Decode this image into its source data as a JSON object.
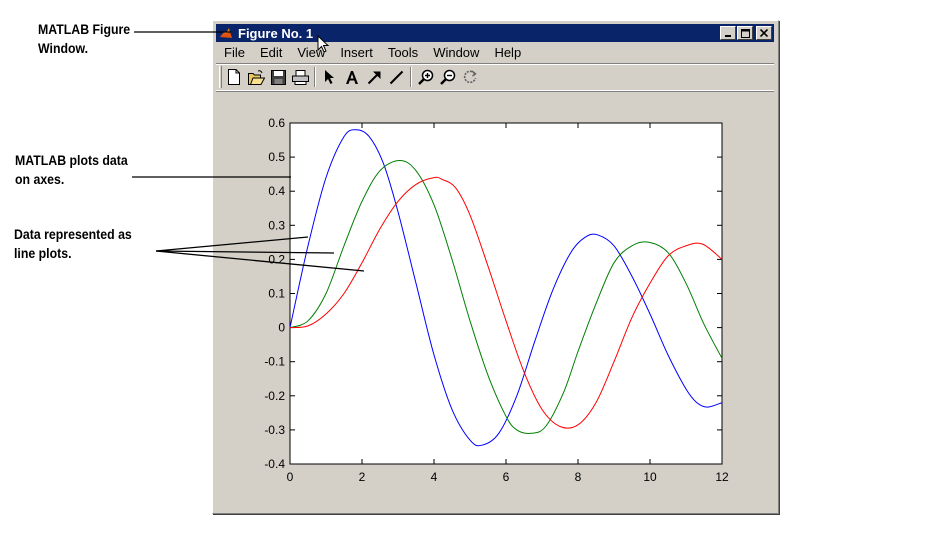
{
  "annotations": {
    "figure_window": [
      "MATLAB Figure",
      "Window."
    ],
    "axes": [
      "MATLAB plots data",
      "on axes."
    ],
    "line_plots": [
      "Data represented as",
      "line plots."
    ]
  },
  "window": {
    "title": "Figure No. 1",
    "controls": [
      "minimize-icon",
      "maximize-icon",
      "close-icon"
    ]
  },
  "menu": {
    "items": [
      "File",
      "Edit",
      "View",
      "Insert",
      "Tools",
      "Window",
      "Help"
    ]
  },
  "toolbar": {
    "groups": [
      [
        "new-file-icon",
        "open-file-icon",
        "save-icon",
        "print-icon"
      ],
      [
        "select-arrow-icon",
        "insert-text-icon",
        "insert-arrow-icon",
        "insert-line-icon"
      ],
      [
        "zoom-in-icon",
        "zoom-out-icon",
        "rotate-3d-icon"
      ]
    ]
  },
  "colors": {
    "title_bar": "#0a246a",
    "window_face": "#d4d0c8",
    "series_1": "#0000ff",
    "series_2": "#008000",
    "series_3": "#ff0000"
  },
  "chart_data": {
    "type": "line",
    "title": "",
    "xlabel": "",
    "ylabel": "",
    "xlim": [
      0,
      12
    ],
    "ylim": [
      -0.4,
      0.6
    ],
    "xticks": [
      0,
      2,
      4,
      6,
      8,
      10,
      12
    ],
    "yticks": [
      -0.4,
      -0.3,
      -0.2,
      -0.1,
      0,
      0.1,
      0.2,
      0.3,
      0.4,
      0.5,
      0.6
    ],
    "grid": false,
    "legend": "none",
    "series": [
      {
        "color": "#0000ff",
        "x": [
          0,
          0.5,
          1,
          1.5,
          1.84,
          2.2,
          2.6,
          3,
          3.5,
          4,
          4.5,
          5,
          5.33,
          5.8,
          6.3,
          6.8,
          7.3,
          7.8,
          8.2,
          8.54,
          9,
          9.5,
          10,
          10.5,
          11,
          11.3,
          11.6,
          12
        ],
        "y": [
          0,
          0.24,
          0.44,
          0.56,
          0.58,
          0.56,
          0.48,
          0.34,
          0.13,
          -0.08,
          -0.24,
          -0.33,
          -0.345,
          -0.31,
          -0.2,
          -0.04,
          0.11,
          0.22,
          0.265,
          0.272,
          0.24,
          0.15,
          0.04,
          -0.08,
          -0.18,
          -0.22,
          -0.233,
          -0.22
        ]
      },
      {
        "color": "#008000",
        "x": [
          0,
          0.5,
          1,
          1.5,
          2,
          2.5,
          3.05,
          3.5,
          4,
          4.5,
          5,
          5.5,
          6,
          6.3,
          6.7,
          7.1,
          7.6,
          8,
          8.5,
          9,
          9.5,
          9.97,
          10.5,
          11,
          11.5,
          12
        ],
        "y": [
          0,
          0.02,
          0.1,
          0.24,
          0.37,
          0.46,
          0.49,
          0.46,
          0.36,
          0.2,
          0.02,
          -0.14,
          -0.26,
          -0.3,
          -0.31,
          -0.29,
          -0.19,
          -0.07,
          0.07,
          0.19,
          0.24,
          0.25,
          0.22,
          0.13,
          0.01,
          -0.09
        ]
      },
      {
        "color": "#ff0000",
        "x": [
          0,
          0.5,
          1,
          1.5,
          2,
          2.5,
          3,
          3.5,
          4,
          4.22,
          4.6,
          5,
          5.5,
          6,
          6.5,
          7,
          7.5,
          8,
          8.5,
          9,
          9.5,
          10,
          10.5,
          11,
          11.46,
          12
        ],
        "y": [
          0,
          0.005,
          0.04,
          0.1,
          0.19,
          0.29,
          0.37,
          0.42,
          0.44,
          0.435,
          0.41,
          0.33,
          0.18,
          0.02,
          -0.13,
          -0.24,
          -0.29,
          -0.285,
          -0.22,
          -0.1,
          0.03,
          0.13,
          0.21,
          0.24,
          0.245,
          0.2
        ]
      }
    ]
  }
}
